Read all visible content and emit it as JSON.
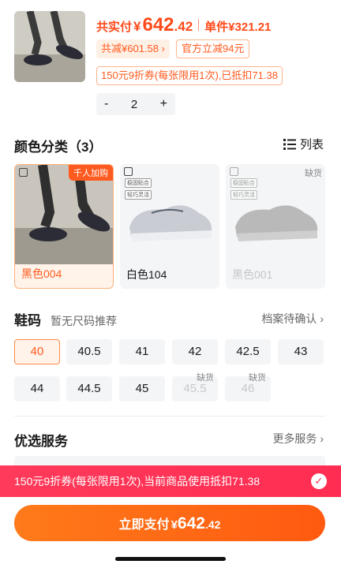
{
  "product": {
    "total_label": "共实付",
    "currency": "¥",
    "price_int": "642",
    "price_dec": ".42",
    "unit_price": "单件¥321.21"
  },
  "tags": {
    "total_discount": "共减¥601.58",
    "official_discount": "官方立减94元",
    "coupon": "150元9折券(每张限用1次),已抵扣71.38"
  },
  "stepper": {
    "minus": "-",
    "value": "2",
    "plus": "+"
  },
  "colors": {
    "title": "颜色分类（3）",
    "list_toggle": "列表",
    "items": [
      {
        "name": "黑色004",
        "badge": "千人加购"
      },
      {
        "name": "白色104",
        "tags": [
          "稳固贴合",
          "轻巧灵活"
        ]
      },
      {
        "name": "黑色001",
        "badge": "缺货",
        "tags": [
          "稳固贴合",
          "轻巧灵活"
        ]
      }
    ]
  },
  "sizes": {
    "title": "鞋码",
    "subtitle": "暂无尺码推荐",
    "link": "档案待确认",
    "items": [
      "40",
      "40.5",
      "41",
      "42",
      "42.5",
      "43",
      "44",
      "44.5",
      "45",
      "45.5",
      "46"
    ],
    "out_of_stock_label": "缺货"
  },
  "services": {
    "title": "优选服务",
    "link": "更多服务"
  },
  "coupon_banner": {
    "text": "150元9折券(每张限用1次),当前商品使用抵扣71.38"
  },
  "pay": {
    "label": "立即支付",
    "currency": "¥",
    "price_int": "642",
    "price_dec": ".42"
  },
  "colors_palette": {
    "accent": "#ff5a1f",
    "banner": "#ff2d52"
  }
}
